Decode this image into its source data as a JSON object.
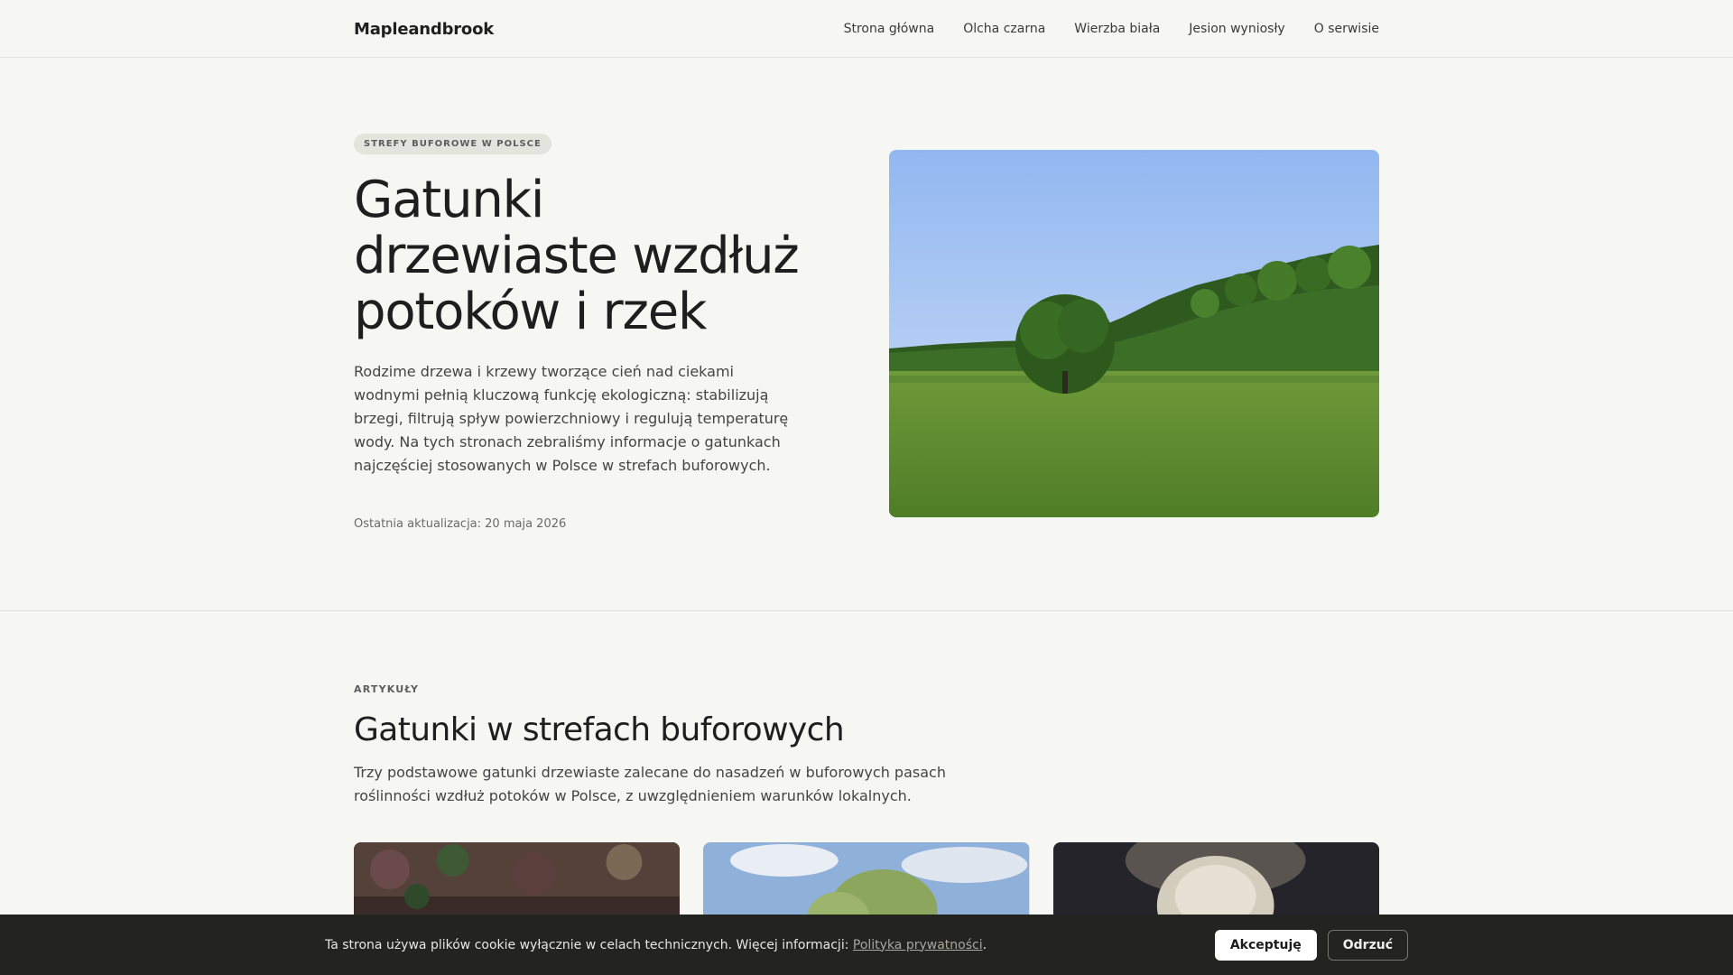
{
  "header": {
    "logo": "Mapleandbrook",
    "nav": [
      "Strona główna",
      "Olcha czarna",
      "Wierzba biała",
      "Jesion wyniosły",
      "O serwisie"
    ]
  },
  "hero": {
    "badge": "STREFY BUFOROWE W POLSCE",
    "title": "Gatunki drzewiaste wzdłuż potoków i rzek",
    "lead": "Rodzime drzewa i krzewy tworzące cień nad ciekami wodnymi pełnią kluczową funkcję ekologiczną: stabilizują brzegi, filtrują spływ powierzchniowy i regulują temperaturę wody. Na tych stronach zebraliśmy informacje o gatunkach najczęściej stosowanych w Polsce w strefach buforowych.",
    "updated": "Ostatnia aktualizacja: 20 maja 2026",
    "image_icon": "meadow-tree-photo"
  },
  "articles": {
    "eyebrow": "ARTYKUŁY",
    "title": "Gatunki w strefach buforowych",
    "lead": "Trzy podstawowe gatunki drzewiaste zalecane do nasadzeń w buforowych pasach roślinności wzdłuż potoków w Polsce, z uwzględnieniem warunków lokalnych.",
    "cards": [
      {
        "image_icon": "alder-bark-photo"
      },
      {
        "image_icon": "willow-sky-photo"
      },
      {
        "image_icon": "ash-seed-photo"
      }
    ]
  },
  "cookie": {
    "text": "Ta strona używa plików cookie wyłącznie w celach technicznych. Więcej informacji: ",
    "link": "Polityka prywatności",
    "after": ".",
    "accept": "Akceptuję",
    "decline": "Odrzuć"
  },
  "colors": {
    "background": "#f6f6f2",
    "cookie_bar": "#23231f",
    "text": "#222222"
  }
}
